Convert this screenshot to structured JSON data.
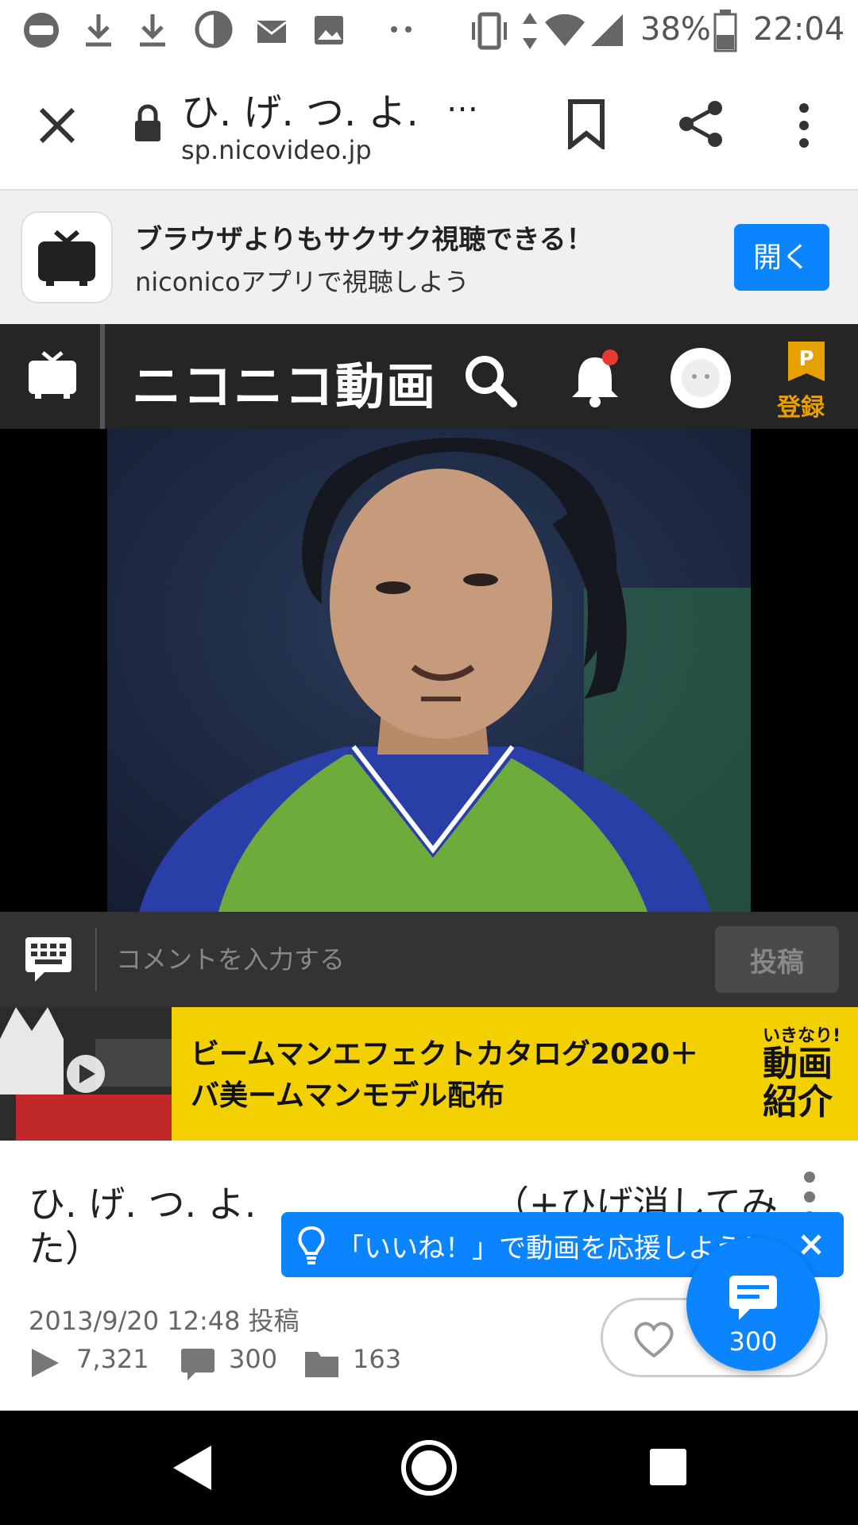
{
  "status_bar": {
    "icons": [
      "line-icon",
      "download-icon",
      "download-icon",
      "data-saver-icon",
      "mail-icon",
      "image-icon",
      "more-dots-icon",
      "vibrate-icon",
      "data-arrows-icon",
      "wifi-icon",
      "signal-icon",
      "battery-icon"
    ],
    "battery": "38%",
    "time": "22:04"
  },
  "toolbar": {
    "title": "ひ. げ. つ. よ.",
    "title_ellipsis": "…",
    "url": "sp.nicovideo.jp"
  },
  "promo": {
    "headline": "ブラウザよりもサクサク視聴できる！",
    "subline": "niconicoアプリで視聴しよう",
    "open_label": "開く"
  },
  "nico_header": {
    "logo": "ニコニコ動画",
    "register_label": "登録",
    "premium_badge": "P"
  },
  "comment_bar": {
    "placeholder": "コメントを入力する",
    "post_label": "投稿"
  },
  "ad": {
    "line1": "ビームマンエフェクトカタログ2020＋",
    "line2": "バ美ームマンモデル配布",
    "tag_small": "いきなり!",
    "tag_big": "動画紹介"
  },
  "video_info": {
    "title_part1": "ひ. げ. つ. よ.",
    "title_part2": "（+ひげ消してみ",
    "title_part3": "た）",
    "posted": "2013/9/20 12:48 投稿",
    "views": "7,321",
    "comments": "300",
    "mylists": "163"
  },
  "tooltip": {
    "text": "「いいね！」で動画を応援しよう！"
  },
  "fab": {
    "count": "300"
  },
  "colors": {
    "accent": "#0a84ff",
    "premium": "#e6a100",
    "notification": "#e53935",
    "header_bg": "#252525"
  }
}
